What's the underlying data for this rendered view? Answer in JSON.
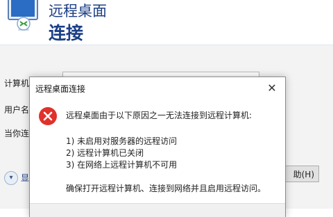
{
  "background_window": {
    "title_line1": "远程桌面",
    "title_line2": "连接",
    "labels": [
      "计算机",
      "用户名",
      "当你连"
    ],
    "options_label": "显",
    "help_button": "助(H)"
  },
  "dialog": {
    "title": "远程桌面连接",
    "close_glyph": "✕",
    "message": "远程桌面由于以下原因之一无法连接到远程计算机:",
    "reasons": [
      "1) 未启用对服务器的远程访问",
      "2) 远程计算机已关闭",
      "3) 在网络上远程计算机不可用"
    ],
    "footer": "确保打开远程计算机、连接到网络并且启用远程访问。"
  },
  "colors": {
    "brand_blue": "#1c3f86",
    "error_red": "#e0312b"
  }
}
